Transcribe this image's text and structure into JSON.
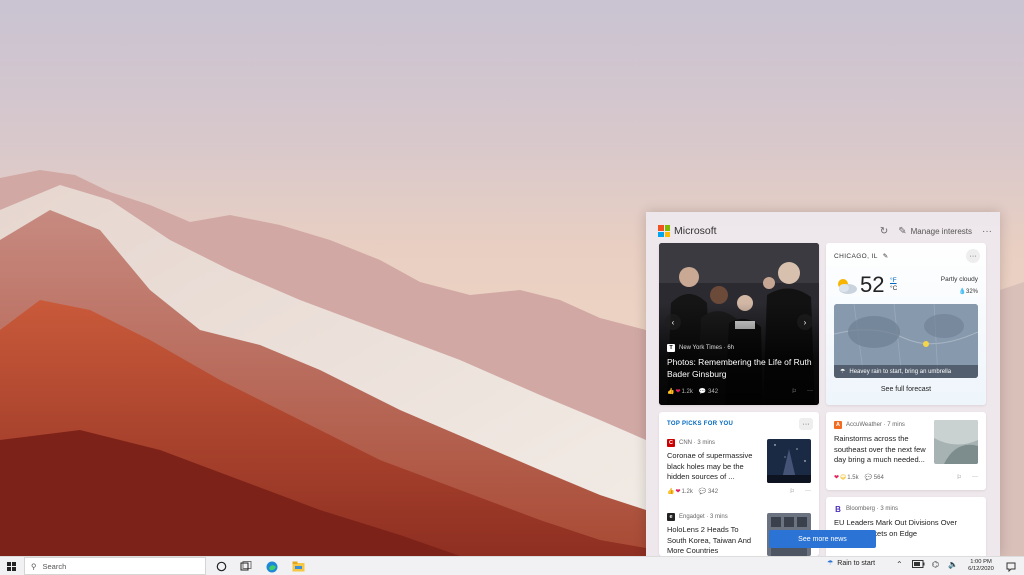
{
  "panel": {
    "brand": "Microsoft",
    "manage_label": "Manage interests",
    "refresh_icon": "refresh-icon",
    "more_icon": "more-icon"
  },
  "hero": {
    "source": "New York Times · 6h",
    "title": "Photos: Remembering the Life of Ruth Bader Ginsburg",
    "reactions": "1.2k",
    "comments": "342"
  },
  "weather": {
    "city": "CHICAGO, IL",
    "temp": "52",
    "unit_f": "°F",
    "unit_c": "°C",
    "condition": "Partly cloudy",
    "precip": "32%",
    "map_caption": "Heavey rain to start, bring an umbrella",
    "forecast_link": "See full forecast"
  },
  "picks": {
    "title": "TOP PICKS FOR YOU",
    "items": [
      {
        "source": "CNN · 3 mins",
        "title": "Coronae of supermassive black holes may be the hidden sources of ...",
        "reactions": "1.2k",
        "comments": "342"
      },
      {
        "source": "Engadget · 3 mins",
        "title": "HoloLens 2 Heads To South Korea, Taiwan And More Countries"
      }
    ]
  },
  "accu": {
    "source": "AccuWeather · 7 mins",
    "title": "Rainstorms across the southeast over the next few day bring a much needed...",
    "reactions": "1.5k",
    "comments": "564"
  },
  "bloomberg": {
    "logo": "B",
    "source": "Bloomberg · 3 mins",
    "title": "EU Leaders Mark Out Divisions Over Turkish Markets on Edge"
  },
  "see_more": "See more news",
  "taskbar": {
    "search_placeholder": "Search",
    "weather_label": "Rain to start",
    "time": "1:00 PM",
    "date": "6/12/2020"
  },
  "colors": {
    "accent": "#0067c0",
    "button": "#2b74d6",
    "ms_red": "#f25022",
    "ms_green": "#7fba00",
    "ms_blue": "#00a4ef",
    "ms_yellow": "#ffb900"
  }
}
